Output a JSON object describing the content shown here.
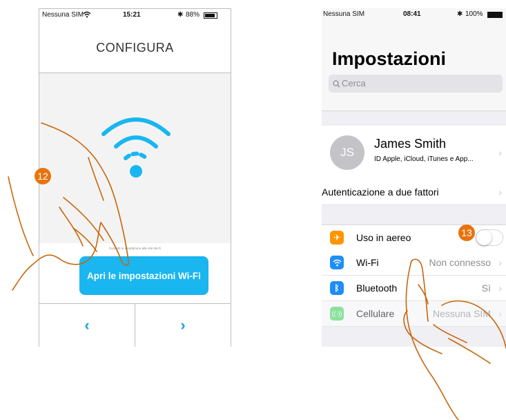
{
  "left_phone": {
    "status": {
      "carrier": "Nessuna SIM",
      "time": "15:21",
      "battery": "88%"
    },
    "title": "CONFIGURA",
    "hint_text": "Connetti lo smartphone alla rete Wi-Fi",
    "main_button": "Apri le impostazioni Wi-Fi",
    "nav_prev": "‹",
    "nav_next": "›",
    "accent": "#19b6f0"
  },
  "right_phone": {
    "status": {
      "carrier": "Nessuna SIM",
      "time": "08:41",
      "battery": "100%"
    },
    "title": "Impostazioni",
    "search_placeholder": "Cerca",
    "profile": {
      "initials": "JS",
      "name": "James Smith",
      "subtitle": "ID Apple, iCloud, iTunes e App..."
    },
    "two_factor": "Autenticazione a due fattori",
    "settings": [
      {
        "label": "Uso in aereo",
        "icon": "airplane-icon",
        "color": "#ff9500",
        "toggle": false
      },
      {
        "label": "Wi-Fi",
        "value": "Non connesso",
        "icon": "wifi-icon",
        "color": "#1e8ef7"
      },
      {
        "label": "Bluetooth",
        "value": "Sì",
        "icon": "bluetooth-icon",
        "color": "#1e8ef7"
      },
      {
        "label": "Cellulare",
        "value": "Nessuna SIM",
        "icon": "cellular-icon",
        "color": "#4cd964"
      }
    ]
  },
  "steps": [
    "12",
    "13"
  ],
  "step_color": "#e8730c"
}
